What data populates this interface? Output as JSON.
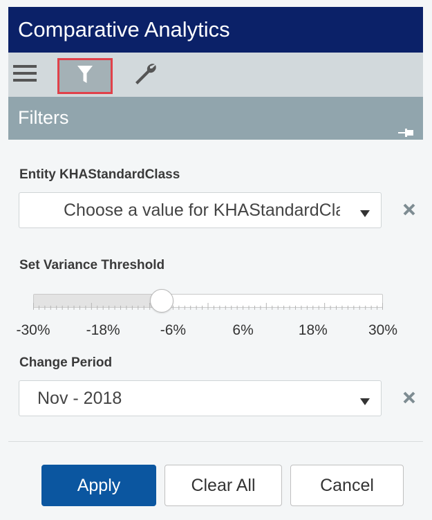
{
  "app": {
    "title": "Comparative Analytics"
  },
  "toolbar": {
    "menu_icon": "hamburger-menu-icon",
    "filter_icon": "funnel-filter-icon",
    "settings_icon": "wrench-icon",
    "active_highlight_color": "#e0414a"
  },
  "filters": {
    "header": "Filters",
    "pin_icon": "pin-icon",
    "entity": {
      "label": "Entity KHAStandardClass",
      "placeholder": "Choose a value for KHAStandardClass"
    },
    "variance": {
      "label": "Set Variance Threshold",
      "min": -30,
      "max": 30,
      "value": -8,
      "ticks": [
        "-30%",
        "-18%",
        "-6%",
        "6%",
        "18%",
        "30%"
      ]
    },
    "change_period": {
      "label": "Change Period",
      "value": "Nov - 2018"
    }
  },
  "actions": {
    "apply": "Apply",
    "clear_all": "Clear All",
    "cancel": "Cancel"
  },
  "colors": {
    "title_bg": "#0b2168",
    "toolbar_bg": "#d2d9dc",
    "filters_header_bg": "#91a5ad",
    "primary": "#0b56a0"
  }
}
